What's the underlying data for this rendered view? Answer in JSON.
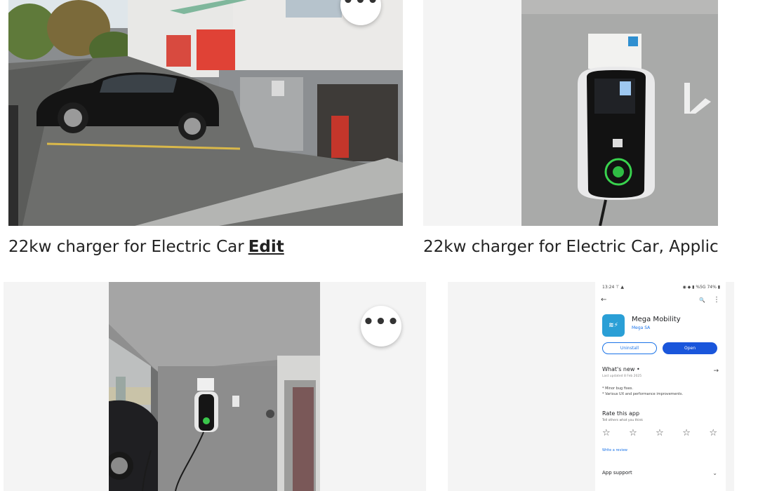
{
  "listings": [
    {
      "caption": "22kw charger for Electric Car",
      "edit_label": "Edit",
      "more_label": "•••"
    },
    {
      "caption": "22kw charger for Electric Car, Applic"
    },
    {
      "more_label": "•••"
    },
    {}
  ],
  "phone": {
    "status_time": "13:24 ⊤ ▲",
    "status_right": "◉ ◆ ▮ %5G 74% ▮",
    "back": "←",
    "search": "🔍",
    "menu": "⋮",
    "icon_text": "≋⚡",
    "app_name": "Mega Mobility",
    "developer": "Mega SA",
    "uninstall_label": "Uninstall",
    "open_label": "Open",
    "whats_new": "What's new •",
    "arrow": "→",
    "updated": "Last updated 8 Feb 2025",
    "note1": "* Minor bug fixes.",
    "note2": "* Various UX and performance improvements.",
    "rate_title": "Rate this app",
    "rate_sub": "Tell others what you think",
    "star": "☆",
    "write_review": "Write a review",
    "app_support": "App support",
    "chevron": "⌄"
  },
  "colors": {
    "accent_blue": "#1a56db",
    "app_icon": "#2a9fd6",
    "caption_text": "#222222"
  }
}
